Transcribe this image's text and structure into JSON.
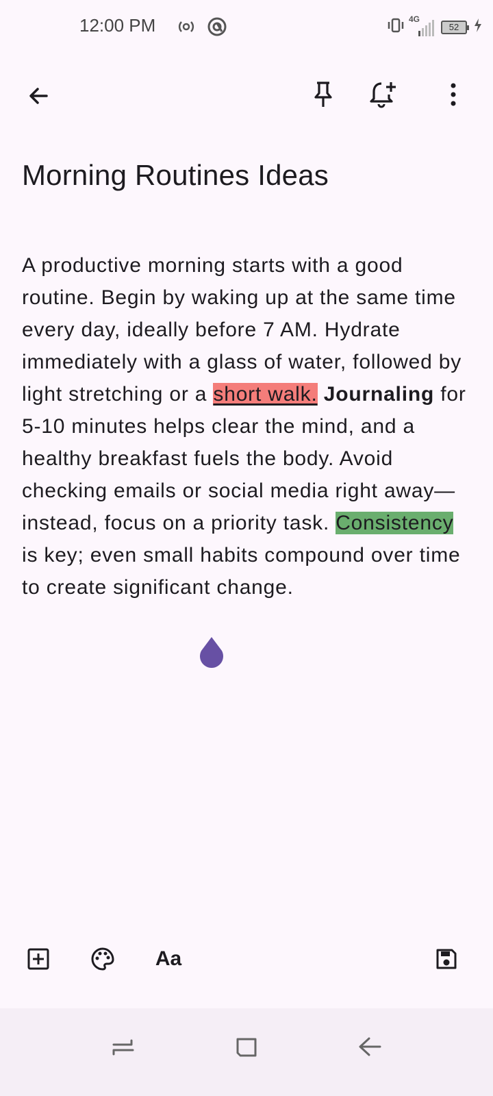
{
  "status_bar": {
    "time": "12:00 PM",
    "network": "4G",
    "battery": "52"
  },
  "app_bar": {
    "back_icon": "arrow-back-icon",
    "pin_icon": "pin-icon",
    "reminder_icon": "add-alert-icon",
    "more_icon": "more-vert-icon"
  },
  "note": {
    "title": "Morning Routines Ideas",
    "body": {
      "part1": "A productive morning starts with a good routine. Begin by waking up at the same time every day, ideally before 7 AM. Hydrate immediately with a glass of water, followed by light stretching or a ",
      "highlight_red": "short walk.",
      "part2": " ",
      "bold_word": "Journaling",
      "part3": " for 5-10 minutes helps clear the mind, and a healthy breakfast fuels the body. Avoid checking emails or social media right away—instead, focus on a priority task. ",
      "highlight_green": "Consistency",
      "part4": " is key; even small habits compound over time to create significant change."
    }
  },
  "toolbar": {
    "add_icon": "add-box-icon",
    "palette_icon": "palette-icon",
    "text_format_label": "Aa",
    "save_icon": "save-icon"
  },
  "colors": {
    "background": "#fdf7fd",
    "highlight_red": "#f47d7a",
    "highlight_green": "#6aae6e",
    "cursor_handle": "#6750a4"
  }
}
